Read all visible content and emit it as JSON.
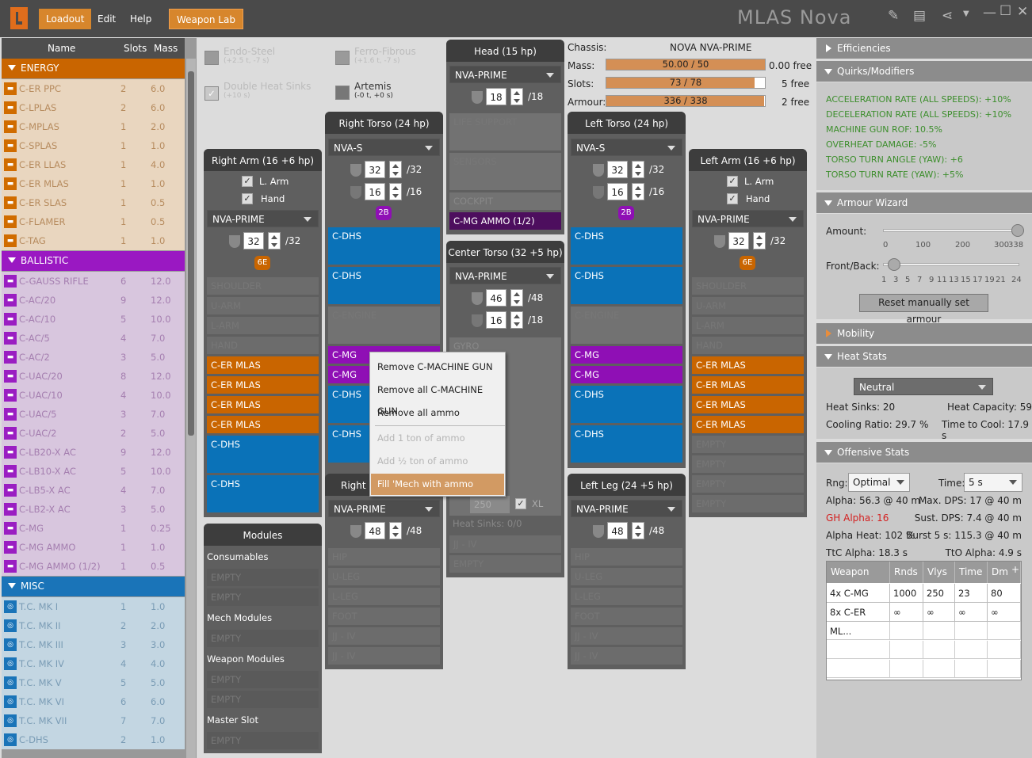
{
  "app": {
    "title": "MLAS Nova",
    "menus": [
      "Loadout",
      "Edit",
      "Help"
    ],
    "weapon_lab": "Weapon Lab"
  },
  "equipment": {
    "headers": [
      "Name",
      "Slots",
      "Mass"
    ],
    "categories": [
      {
        "name": "ENERGY",
        "items": [
          [
            "C-ER PPC",
            "2",
            "6.0"
          ],
          [
            "C-LPLAS",
            "2",
            "6.0"
          ],
          [
            "C-MPLAS",
            "1",
            "2.0"
          ],
          [
            "C-SPLAS",
            "1",
            "1.0"
          ],
          [
            "C-ER LLAS",
            "1",
            "4.0"
          ],
          [
            "C-ER MLAS",
            "1",
            "1.0"
          ],
          [
            "C-ER SLAS",
            "1",
            "0.5"
          ],
          [
            "C-FLAMER",
            "1",
            "0.5"
          ],
          [
            "C-TAG",
            "1",
            "1.0"
          ]
        ]
      },
      {
        "name": "BALLISTIC",
        "items": [
          [
            "C-GAUSS RIFLE",
            "6",
            "12.0"
          ],
          [
            "C-AC/20",
            "9",
            "12.0"
          ],
          [
            "C-AC/10",
            "5",
            "10.0"
          ],
          [
            "C-AC/5",
            "4",
            "7.0"
          ],
          [
            "C-AC/2",
            "3",
            "5.0"
          ],
          [
            "C-UAC/20",
            "8",
            "12.0"
          ],
          [
            "C-UAC/10",
            "4",
            "10.0"
          ],
          [
            "C-UAC/5",
            "3",
            "7.0"
          ],
          [
            "C-UAC/2",
            "2",
            "5.0"
          ],
          [
            "C-LB20-X AC",
            "9",
            "12.0"
          ],
          [
            "C-LB10-X AC",
            "5",
            "10.0"
          ],
          [
            "C-LB5-X AC",
            "4",
            "7.0"
          ],
          [
            "C-LB2-X AC",
            "3",
            "5.0"
          ],
          [
            "C-MG",
            "1",
            "0.25"
          ],
          [
            "C-MG AMMO",
            "1",
            "1.0"
          ],
          [
            "C-MG AMMO (1/2)",
            "1",
            "0.5"
          ]
        ]
      },
      {
        "name": "MISC",
        "items": [
          [
            "T.C. MK I",
            "1",
            "1.0"
          ],
          [
            "T.C. MK II",
            "2",
            "2.0"
          ],
          [
            "T.C. MK III",
            "3",
            "3.0"
          ],
          [
            "T.C. MK IV",
            "4",
            "4.0"
          ],
          [
            "T.C. MK V",
            "5",
            "5.0"
          ],
          [
            "T.C. MK VI",
            "6",
            "6.0"
          ],
          [
            "T.C. MK VII",
            "7",
            "7.0"
          ],
          [
            "C-DHS",
            "2",
            "1.0"
          ]
        ]
      }
    ]
  },
  "upgrades": {
    "endo": {
      "label": "Endo-Steel",
      "sub": "(+2.5 t, -7 s)"
    },
    "ferro": {
      "label": "Ferro-Fibrous",
      "sub": "(+1.6 t, -7 s)"
    },
    "dhs": {
      "label": "Double Heat Sinks",
      "sub": "(+10 s)"
    },
    "artemis": {
      "label": "Artemis",
      "sub": "(-0 t, +0 s)"
    }
  },
  "chassis": {
    "label": "Chassis:",
    "value": "NOVA NVA-PRIME",
    "mass_label": "Mass:",
    "mass": "50.00 / 50",
    "mass_free": "0.00 free",
    "mass_frac": 1.0,
    "slots_label": "Slots:",
    "slots": "73 / 78",
    "slots_free": "5 free",
    "slots_frac": 0.936,
    "armour_label": "Armour:",
    "armour": "336 / 338",
    "armour_free": "2 free",
    "armour_frac": 0.994
  },
  "parts": {
    "ra": {
      "title": "Right Arm (16 +6 hp)",
      "larm": "L. Arm",
      "hand": "Hand",
      "omni": "NVA-PRIME",
      "armor": "32",
      "max": "/32",
      "hp": "6E",
      "slots": [
        "SHOULDER",
        "U-ARM",
        "L-ARM",
        "HAND",
        "C-ER MLAS",
        "C-ER MLAS",
        "C-ER MLAS",
        "C-ER MLAS",
        "C-DHS",
        "C-DHS"
      ]
    },
    "rt": {
      "title": "Right Torso (24 hp)",
      "omni": "NVA-S",
      "armor": "32",
      "max": "/32",
      "rear": "16",
      "rmax": "/16",
      "hp": "2B",
      "slots": [
        "C-DHS",
        "C-DHS",
        "C-ENGINE",
        "C-MG",
        "C-MG",
        "C-DHS",
        "C-DHS"
      ]
    },
    "head": {
      "title": "Head (15 hp)",
      "omni": "NVA-PRIME",
      "armor": "18",
      "max": "/18",
      "slots": [
        "LIFE SUPPORT",
        "SENSORS",
        "COCKPIT",
        "C-MG AMMO (1/2)"
      ]
    },
    "ct": {
      "title": "Center Torso (32 +5 hp)",
      "omni": "NVA-PRIME",
      "armor": "46",
      "max": "/48",
      "rear": "16",
      "rmax": "/18",
      "slots": [
        "GYRO",
        "Heat Sinks: 0/0",
        "JJ - IV",
        "EMPTY"
      ],
      "eng": "250",
      "xl": "XL"
    },
    "lt": {
      "title": "Left Torso (24 hp)",
      "omni": "NVA-S",
      "armor": "32",
      "max": "/32",
      "rear": "16",
      "rmax": "/16",
      "hp": "2B",
      "slots": [
        "C-DHS",
        "C-DHS",
        "C-ENGINE",
        "C-MG",
        "C-MG",
        "C-DHS",
        "C-DHS"
      ]
    },
    "la": {
      "title": "Left Arm (16 +6 hp)",
      "larm": "L. Arm",
      "hand": "Hand",
      "omni": "NVA-PRIME",
      "armor": "32",
      "max": "/32",
      "hp": "6E",
      "slots": [
        "SHOULDER",
        "U-ARM",
        "L-ARM",
        "HAND",
        "C-ER MLAS",
        "C-ER MLAS",
        "C-ER MLAS",
        "C-ER MLAS",
        "EMPTY",
        "EMPTY",
        "EMPTY",
        "EMPTY"
      ]
    },
    "rl": {
      "title": "Right L",
      "omni": "NVA-PRIME",
      "armor": "48",
      "max": "/48",
      "slots": [
        "HIP",
        "U-LEG",
        "L-LEG",
        "FOOT",
        "JJ - IV",
        "JJ - IV"
      ]
    },
    "ll": {
      "title": "Left Leg (24 +5 hp)",
      "omni": "NVA-PRIME",
      "armor": "48",
      "max": "/48",
      "slots": [
        "HIP",
        "U-LEG",
        "L-LEG",
        "FOOT",
        "JJ - IV",
        "JJ - IV"
      ]
    }
  },
  "modules": {
    "title": "Modules",
    "consumables": "Consumables",
    "mech": "Mech Modules",
    "weapon": "Weapon Modules",
    "master": "Master Slot",
    "empty": "EMPTY"
  },
  "context_menu": [
    "Remove C-MACHINE GUN",
    "Remove all C-MACHINE GUN",
    "Remove all ammo",
    "Add 1 ton of ammo",
    "Add ½ ton of ammo",
    "Fill 'Mech with ammo"
  ],
  "right": {
    "efficiencies": "Efficiencies",
    "quirks_title": "Quirks/Modifiers",
    "quirks": [
      "ACCELERATION RATE (ALL SPEEDS): +10%",
      "DECELERATION RATE (ALL SPEEDS): +10%",
      "MACHINE GUN ROF: 10.5%",
      "OVERHEAT DAMAGE: -5%",
      "TORSO TURN ANGLE (YAW): +6",
      "TORSO TURN RATE (YAW): +5%"
    ],
    "armour_wizard": "Armour Wizard",
    "amount": "Amount:",
    "amount_ticks": [
      "0",
      "100",
      "200",
      "300",
      "338"
    ],
    "amount_frac": 1.0,
    "frontback": "Front/Back:",
    "fb_ticks": [
      "1",
      "3",
      "5",
      "7",
      "9",
      "11",
      "13",
      "15",
      "17",
      "19",
      "21",
      "24"
    ],
    "fb_frac": 0.0,
    "reset": "Reset manually set armour",
    "mobility": "Mobility",
    "heat_stats": "Heat Stats",
    "heat_select": "Neutral",
    "heat_sinks": "Heat Sinks: 20",
    "heat_cap": "Heat Capacity: 59",
    "cooling": "Cooling Ratio: 29.7 %",
    "time_cool": "Time to Cool: 17.9 s",
    "offensive": "Offensive Stats",
    "rng_label": "Rng:",
    "rng": "Optimal",
    "time_label": "Time:",
    "time": "5 s",
    "stats": [
      [
        "Alpha: 56.3 @ 40 m",
        "Max. DPS: 17 @ 40 m"
      ],
      [
        "GH Alpha: 16",
        "Sust. DPS: 7.4 @ 40 m"
      ],
      [
        "Alpha Heat: 102 %",
        "Burst 5 s: 115.3 @ 40 m"
      ],
      [
        "TtC Alpha: 18.3 s",
        "TtO Alpha: 4.9 s"
      ]
    ],
    "table_headers": [
      "Weapon",
      "Rnds",
      "Vlys",
      "Time",
      "Dm"
    ],
    "table_rows": [
      [
        "4x C-MG",
        "1000",
        "250",
        "23",
        "80"
      ],
      [
        "8x C-ER ML...",
        "∞",
        "∞",
        "∞",
        "∞"
      ]
    ]
  }
}
